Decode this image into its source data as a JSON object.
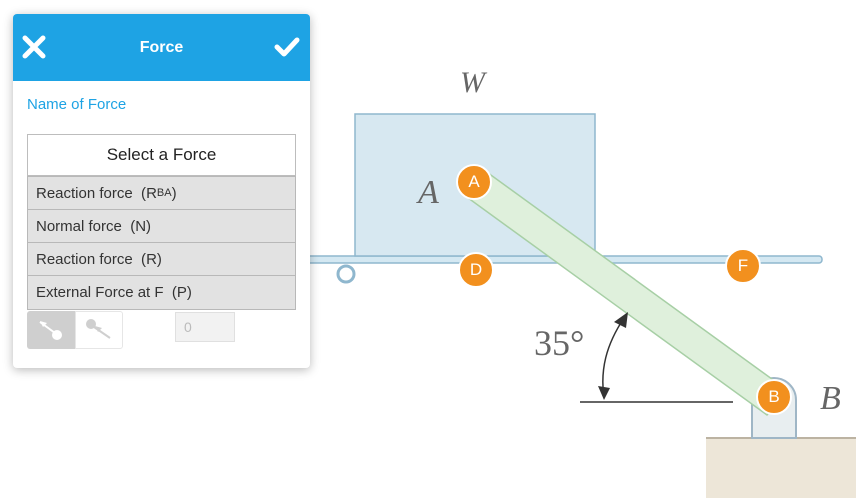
{
  "panel": {
    "title": "Force",
    "name_label": "Name of Force",
    "select_placeholder": "Select a Force",
    "options": [
      {
        "label": "Reaction force",
        "sym": "R",
        "sub": "BA"
      },
      {
        "label": "Normal force",
        "sym": "N",
        "sub": ""
      },
      {
        "label": "Reaction force",
        "sym": "R",
        "sub": ""
      },
      {
        "label": "External Force at F",
        "sym": "P",
        "sub": ""
      }
    ],
    "magnitude_value": "0",
    "close_icon": "close-icon",
    "confirm_icon": "check-icon"
  },
  "diagram": {
    "block_label": "W",
    "label_A": "A",
    "label_B": "B",
    "angle": "35°",
    "points": [
      {
        "id": "A"
      },
      {
        "id": "D"
      },
      {
        "id": "F"
      },
      {
        "id": "B"
      }
    ]
  },
  "colors": {
    "accent": "#1ea3e4",
    "point_marker": "#f2901e",
    "block_fill": "#d7e8f1",
    "rod_fill": "#dff0dc",
    "ground": "#ede6d8"
  }
}
